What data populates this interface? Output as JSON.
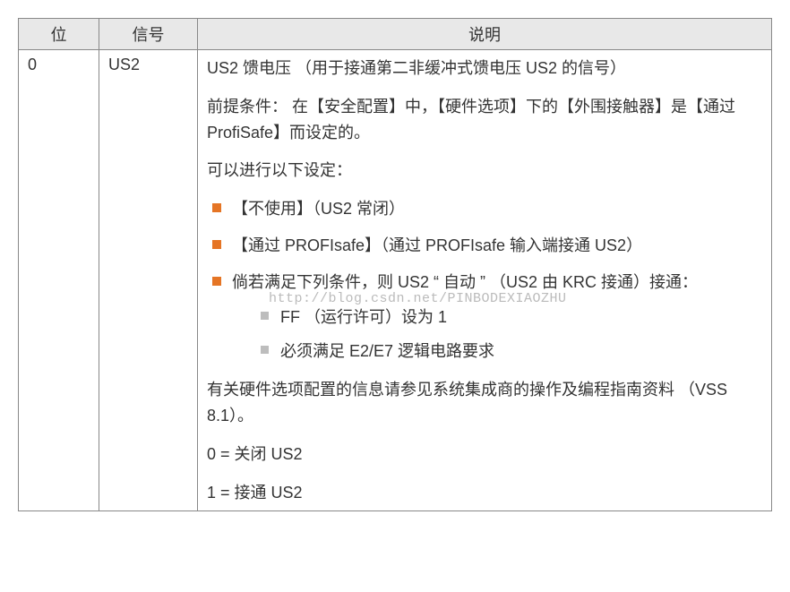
{
  "headers": {
    "bit": "位",
    "signal": "信号",
    "desc": "说明"
  },
  "row": {
    "bit": "0",
    "signal": "US2",
    "p1": "US2 馈电压 （用于接通第二非缓冲式馈电压 US2 的信号）",
    "p2": "前提条件： 在【安全配置】中，【硬件选项】下的【外围接触器】是【通过 ProfiSafe】而设定的。",
    "p3": "可以进行以下设定：",
    "b1": "【不使用】（US2 常闭）",
    "b2": "【通过 PROFIsafe】（通过 PROFIsafe 输入端接通 US2）",
    "b3": "倘若满足下列条件，则 US2 “ 自动 ” （US2 由 KRC 接通）接通：",
    "s1": "FF （运行许可）设为 1",
    "s2": "必须满足 E2/E7 逻辑电路要求",
    "p4": "有关硬件选项配置的信息请参见系统集成商的操作及编程指南资料 （VSS 8.1）。",
    "p5": "0 = 关闭 US2",
    "p6": "1 = 接通 US2"
  },
  "watermark": "http://blog.csdn.net/PINBODEXIAOZHU"
}
